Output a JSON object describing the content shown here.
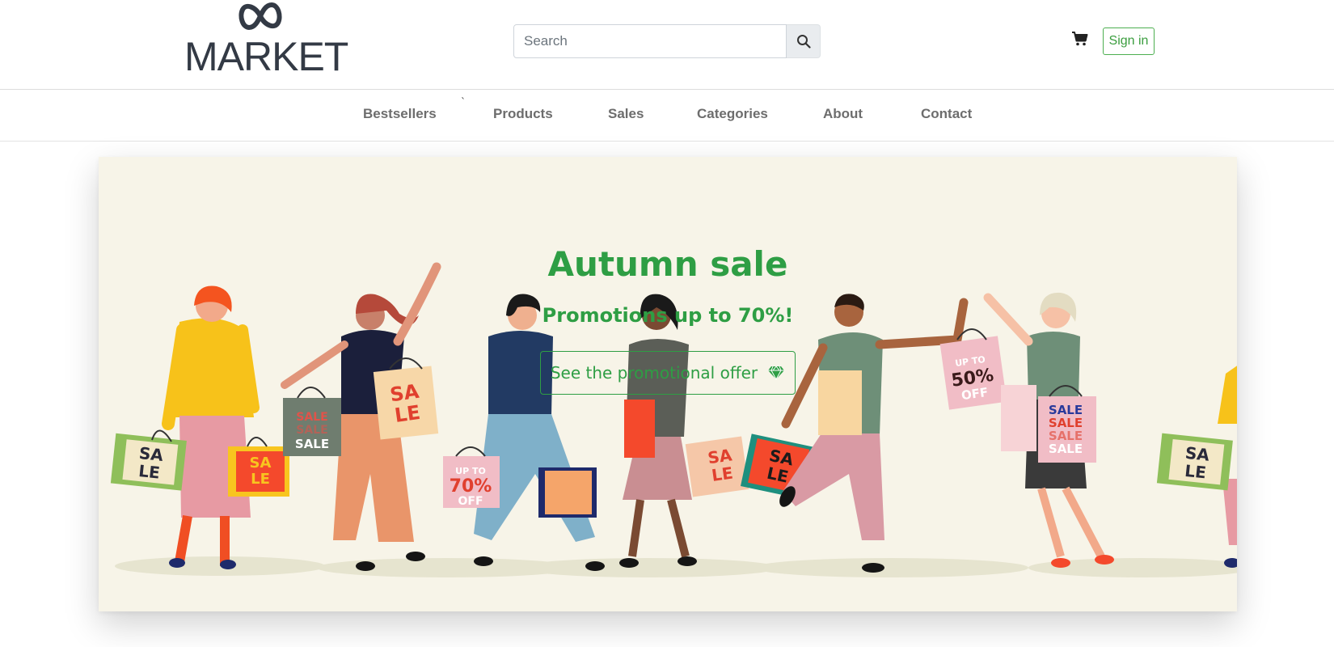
{
  "brand": {
    "logo_text": "MARKET",
    "logo_icon": "infinity-logo-icon"
  },
  "search": {
    "placeholder": "Search",
    "value": "",
    "icon": "search-icon"
  },
  "header": {
    "cart_icon": "cart-icon",
    "signin_label": "Sign in"
  },
  "nav": {
    "tick": "`",
    "items": [
      {
        "label": "Bestsellers"
      },
      {
        "label": "Products"
      },
      {
        "label": "Sales"
      },
      {
        "label": "Categories"
      },
      {
        "label": "About"
      },
      {
        "label": "Contact"
      }
    ]
  },
  "banner": {
    "title": "Autumn sale",
    "subtitle": "Promotions up to 70%!",
    "cta_label": "See the promotional offer",
    "cta_icon": "gem-icon",
    "illustration": "shoppers-with-sale-bags-illustration",
    "bag_texts": {
      "sale": "SALE",
      "sa": "SA",
      "le": "LE",
      "up_to": "UP TO",
      "pct70": "70%",
      "pct50": "50%",
      "off": "OFF"
    }
  },
  "colors": {
    "accent_green": "#2e9e44",
    "banner_bg": "#f7f4e8",
    "nav_text": "#6d6d6d",
    "logo": "#333a45"
  }
}
